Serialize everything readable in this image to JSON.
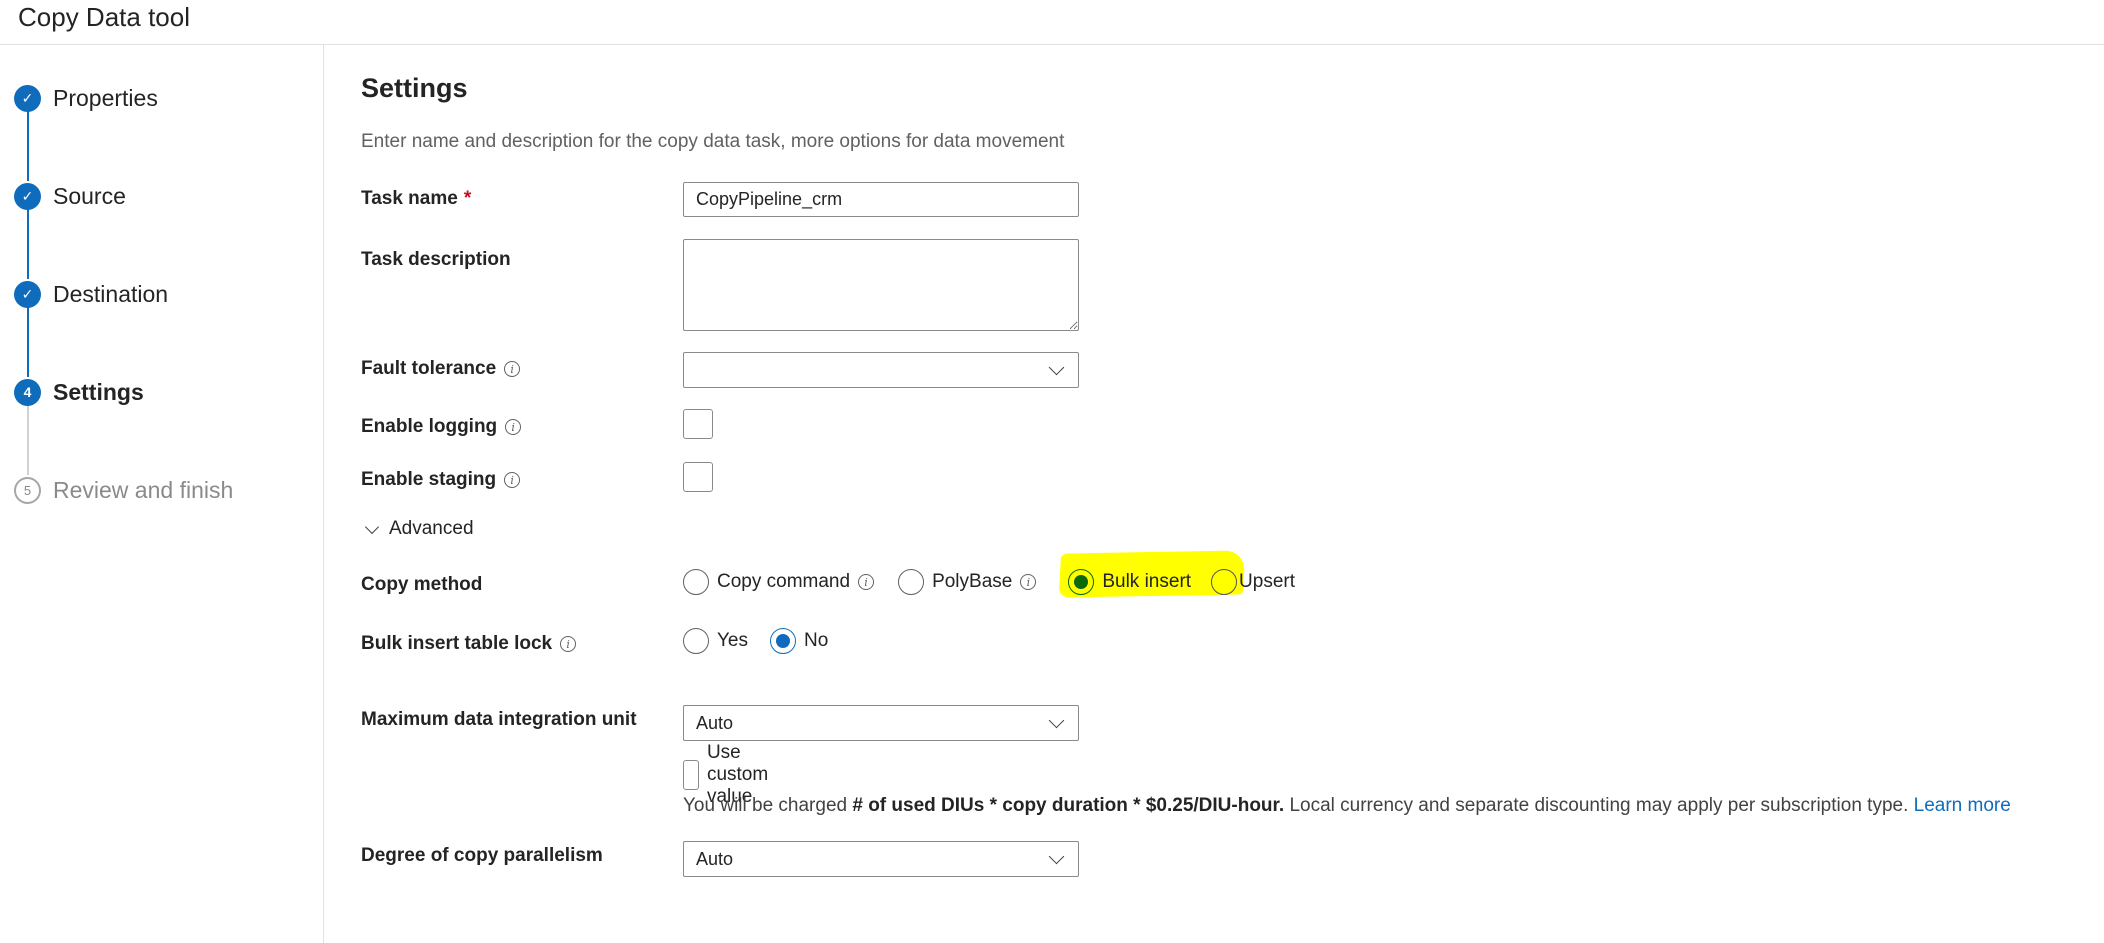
{
  "app": {
    "title": "Copy Data tool"
  },
  "steps": [
    {
      "label": "Properties",
      "badge": "✓",
      "state": "done"
    },
    {
      "label": "Source",
      "badge": "✓",
      "state": "done"
    },
    {
      "label": "Destination",
      "badge": "✓",
      "state": "done"
    },
    {
      "label": "Settings",
      "badge": "4",
      "state": "active"
    },
    {
      "label": "Review and finish",
      "badge": "5",
      "state": "pending"
    }
  ],
  "settings": {
    "title": "Settings",
    "description": "Enter name and description for the copy data task, more options for data movement",
    "task_name": {
      "label": "Task name",
      "required_mark": "*",
      "value": "CopyPipeline_crm"
    },
    "task_description": {
      "label": "Task description",
      "value": ""
    },
    "fault_tolerance": {
      "label": "Fault tolerance",
      "value": ""
    },
    "enable_logging": {
      "label": "Enable logging",
      "checked": false
    },
    "enable_staging": {
      "label": "Enable staging",
      "checked": false
    },
    "advanced": {
      "label": "Advanced",
      "expanded": true
    },
    "copy_method": {
      "label": "Copy method",
      "options": [
        "Copy command",
        "PolyBase",
        "Bulk insert",
        "Upsert"
      ],
      "selected": "Bulk insert"
    },
    "table_lock": {
      "label": "Bulk insert table lock",
      "options": [
        "Yes",
        "No"
      ],
      "selected": "No"
    },
    "max_diu": {
      "label": "Maximum data integration unit",
      "value": "Auto",
      "custom_label": "Use custom value",
      "custom_checked": false
    },
    "charge_note": {
      "prefix": "You will be charged ",
      "formula": "# of used DIUs * copy duration * $0.25/DIU-hour.",
      "suffix": " Local currency and separate discounting may apply per subscription type. ",
      "link": "Learn more"
    },
    "parallelism": {
      "label": "Degree of copy parallelism",
      "value": "Auto"
    }
  },
  "colors": {
    "accent": "#0f6cbd",
    "highlight": "#ffff00",
    "required": "#c50f1f"
  },
  "icons": {
    "check": "check-icon",
    "info": "info-icon",
    "chevron": "chevron-down-icon"
  }
}
